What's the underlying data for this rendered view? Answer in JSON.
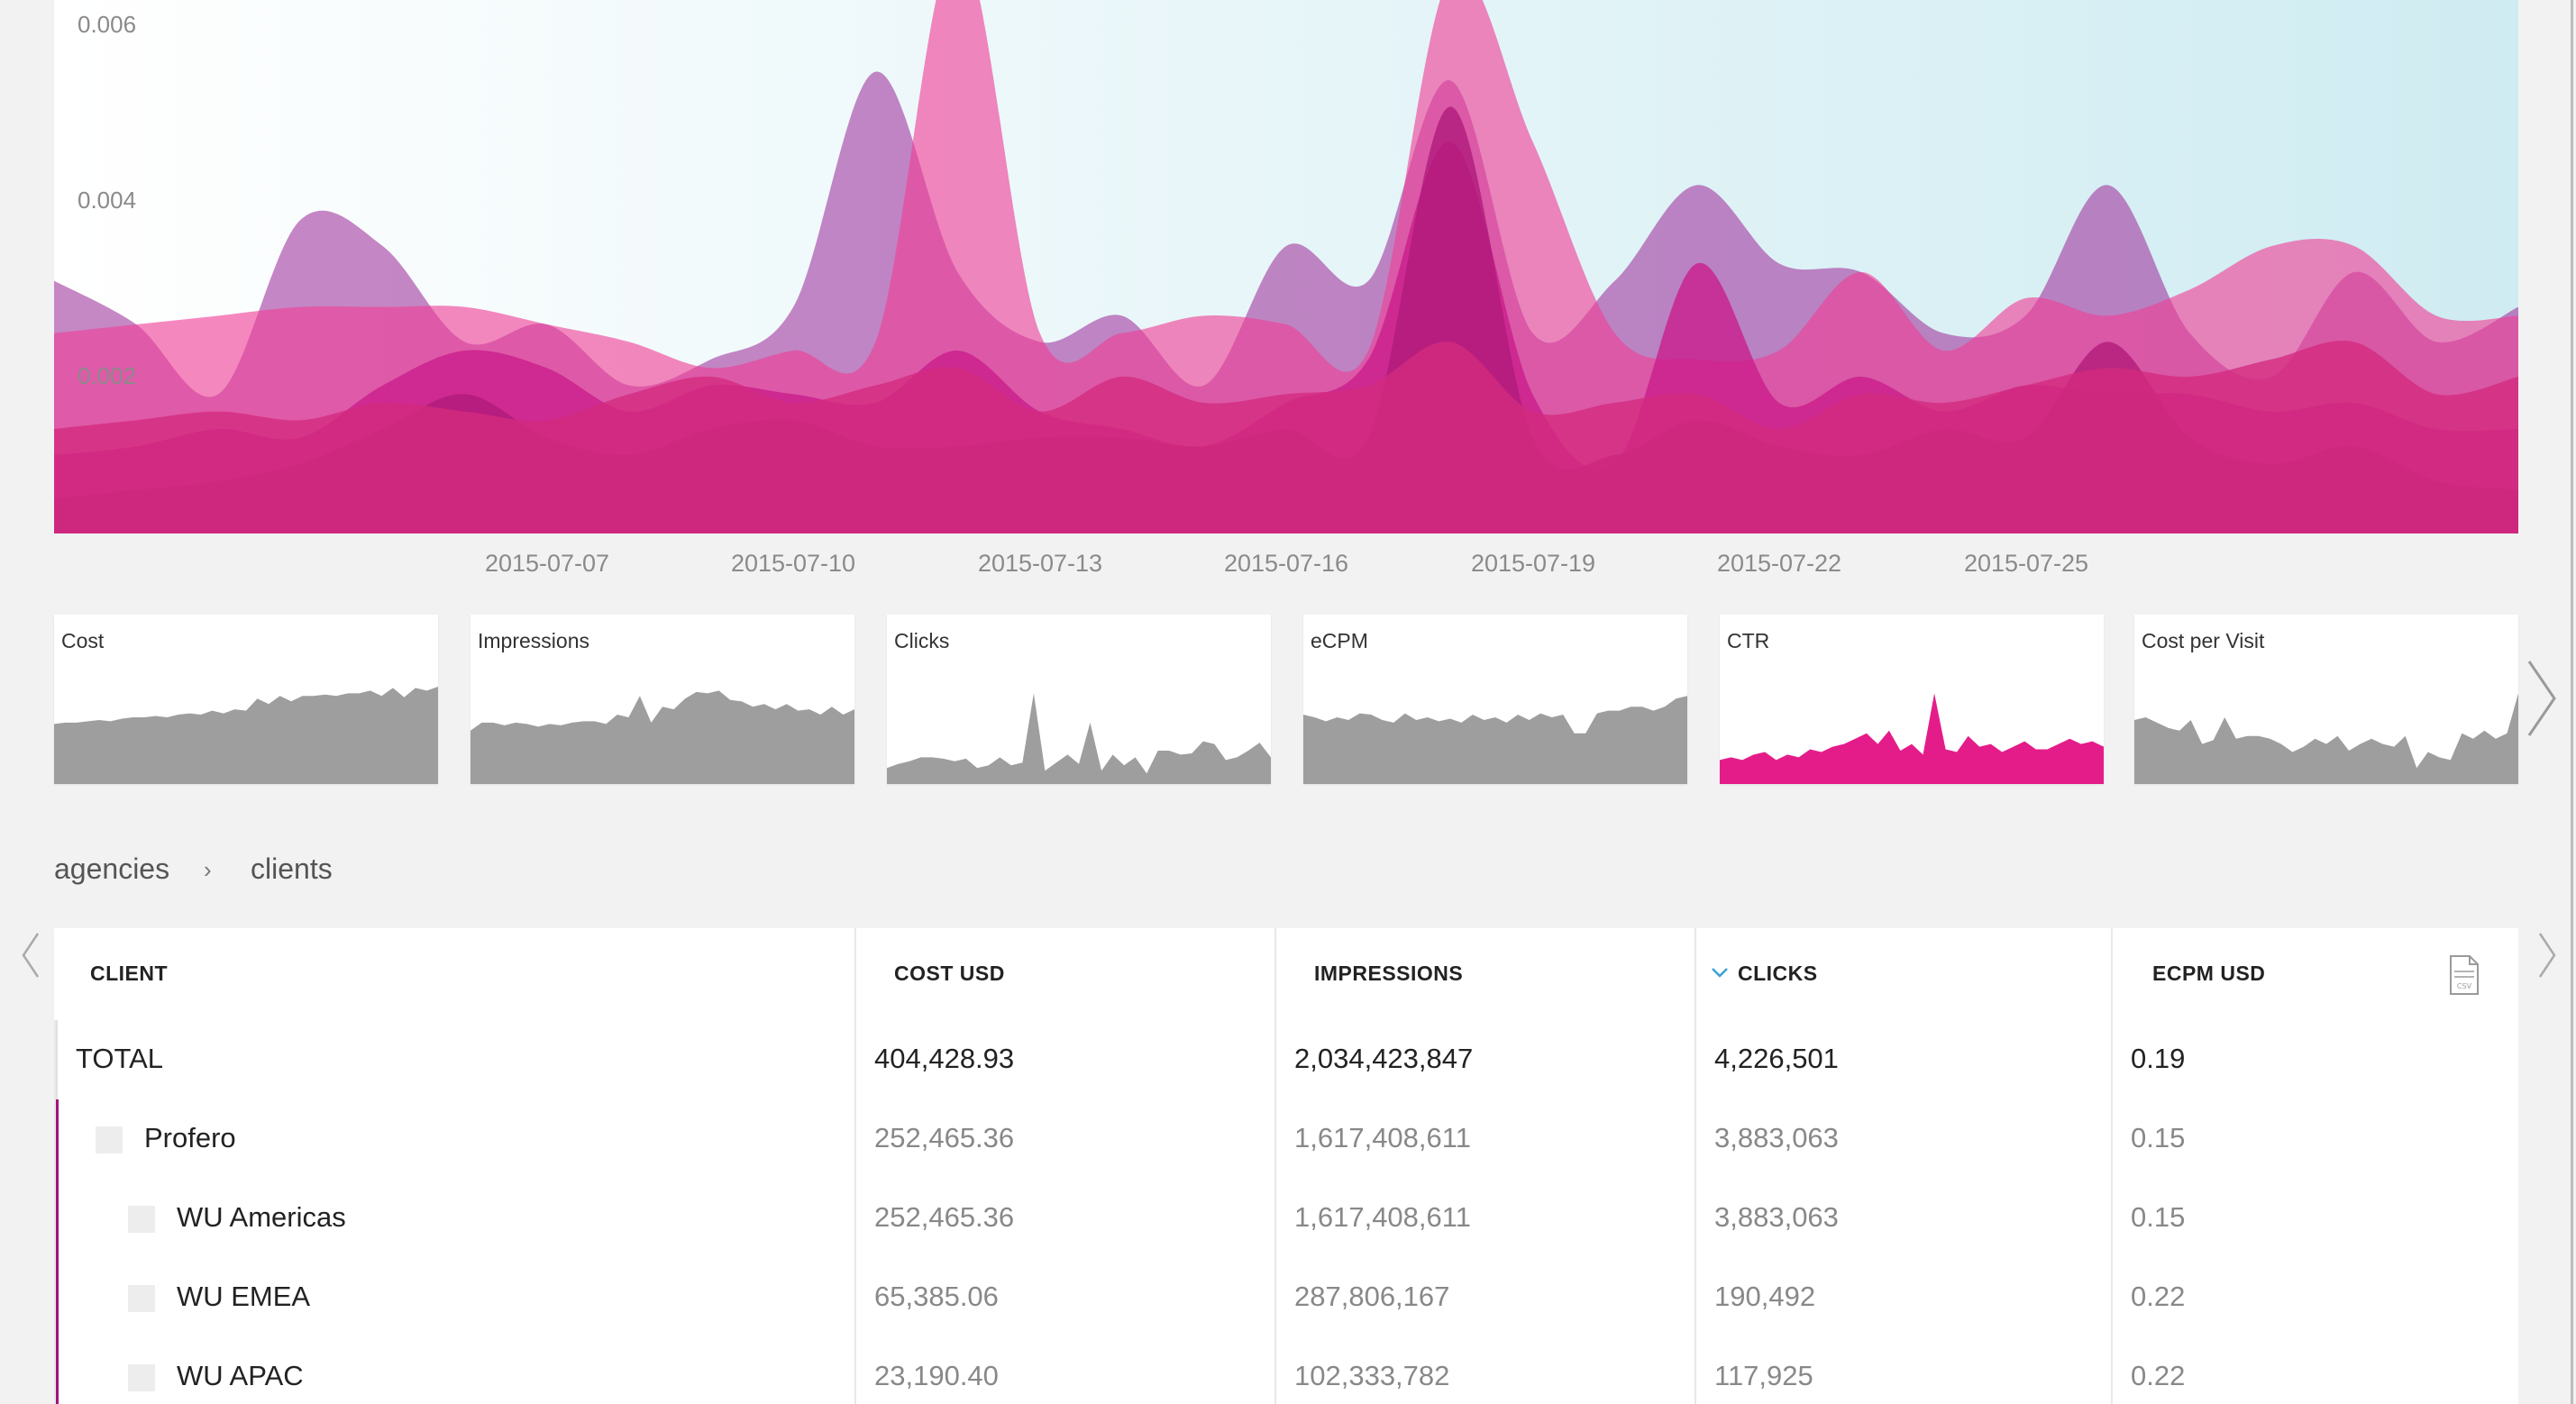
{
  "main_chart": {
    "y_ticks": [
      "0.006",
      "0.004",
      "0.002"
    ],
    "x_ticks": [
      "2015-07-07",
      "2015-07-10",
      "2015-07-13",
      "2015-07-16",
      "2015-07-19",
      "2015-07-22",
      "2015-07-25"
    ],
    "colors": [
      "#a33ea1",
      "#ef3f96",
      "#c91c8a",
      "#b01a7a",
      "#d42a7e"
    ]
  },
  "chart_data": {
    "type": "area",
    "x": [
      "2015-07-02",
      "2015-07-03",
      "2015-07-04",
      "2015-07-05",
      "2015-07-06",
      "2015-07-07",
      "2015-07-08",
      "2015-07-09",
      "2015-07-10",
      "2015-07-11",
      "2015-07-12",
      "2015-07-13",
      "2015-07-14",
      "2015-07-15",
      "2015-07-16",
      "2015-07-17",
      "2015-07-18",
      "2015-07-19",
      "2015-07-20",
      "2015-07-21",
      "2015-07-22",
      "2015-07-23",
      "2015-07-24",
      "2015-07-25",
      "2015-07-26",
      "2015-07-27",
      "2015-07-28",
      "2015-07-29",
      "2015-07-30",
      "2015-07-31",
      "2015-08-01"
    ],
    "ylim": [
      0,
      0.006
    ],
    "series": [
      {
        "values": [
          0.0029,
          0.0024,
          0.0016,
          0.0036,
          0.0033,
          0.0022,
          0.0024,
          0.0017,
          0.002,
          0.0026,
          0.0053,
          0.003,
          0.0022,
          0.0025,
          0.0017,
          0.0033,
          0.0029,
          0.0052,
          0.0023,
          0.0029,
          0.004,
          0.0031,
          0.003,
          0.0023,
          0.0025,
          0.004,
          0.0023,
          0.0018,
          0.003,
          0.0022,
          0.0026
        ]
      },
      {
        "values": [
          0.0023,
          0.0024,
          0.0025,
          0.0026,
          0.0026,
          0.0026,
          0.0024,
          0.0022,
          0.0019,
          0.0021,
          0.0022,
          0.0068,
          0.0023,
          0.0023,
          0.0025,
          0.0024,
          0.0021,
          0.0064,
          0.0045,
          0.0023,
          0.002,
          0.0021,
          0.003,
          0.0021,
          0.0027,
          0.0025,
          0.0028,
          0.0033,
          0.0033,
          0.0025,
          0.0025
        ]
      },
      {
        "values": [
          0.0009,
          0.001,
          0.0012,
          0.0011,
          0.0017,
          0.0021,
          0.0019,
          0.0014,
          0.0017,
          0.0016,
          0.0015,
          0.0021,
          0.0014,
          0.0012,
          0.001,
          0.0015,
          0.002,
          0.0045,
          0.0016,
          0.0008,
          0.0031,
          0.0015,
          0.0018,
          0.0014,
          0.0017,
          0.0016,
          0.0016,
          0.0014,
          0.0015,
          0.0012,
          0.0012
        ]
      },
      {
        "values": [
          0.0004,
          0.0005,
          0.0006,
          0.0008,
          0.0012,
          0.0016,
          0.0011,
          0.0009,
          0.0012,
          0.0013,
          0.001,
          0.001,
          0.0011,
          0.0011,
          0.001,
          0.0012,
          0.0011,
          0.0049,
          0.0011,
          0.0009,
          0.0013,
          0.001,
          0.0009,
          0.0012,
          0.0011,
          0.0022,
          0.0011,
          0.0008,
          0.001,
          0.0006,
          0.0005
        ]
      },
      {
        "values": [
          0.0012,
          0.0013,
          0.0014,
          0.0013,
          0.0015,
          0.0014,
          0.0013,
          0.0016,
          0.0018,
          0.0015,
          0.0017,
          0.0019,
          0.0014,
          0.0018,
          0.0015,
          0.0016,
          0.0017,
          0.0022,
          0.0014,
          0.0015,
          0.0016,
          0.0012,
          0.0016,
          0.0015,
          0.0017,
          0.0019,
          0.0018,
          0.002,
          0.0022,
          0.0016,
          0.0018
        ]
      }
    ]
  },
  "mini_charts": [
    {
      "label": "Cost",
      "color": "#9e9e9e",
      "values": [
        0.45,
        0.46,
        0.46,
        0.47,
        0.48,
        0.47,
        0.49,
        0.5,
        0.5,
        0.51,
        0.5,
        0.52,
        0.53,
        0.52,
        0.55,
        0.53,
        0.56,
        0.55,
        0.64,
        0.6,
        0.66,
        0.62,
        0.66,
        0.66,
        0.67,
        0.66,
        0.68,
        0.68,
        0.7,
        0.66,
        0.72,
        0.65,
        0.72,
        0.7,
        0.73
      ]
    },
    {
      "label": "Impressions",
      "color": "#9e9e9e",
      "values": [
        0.4,
        0.46,
        0.46,
        0.44,
        0.46,
        0.45,
        0.43,
        0.45,
        0.44,
        0.46,
        0.47,
        0.47,
        0.45,
        0.52,
        0.5,
        0.66,
        0.46,
        0.58,
        0.56,
        0.64,
        0.69,
        0.68,
        0.7,
        0.63,
        0.62,
        0.58,
        0.6,
        0.56,
        0.6,
        0.55,
        0.56,
        0.52,
        0.58,
        0.52,
        0.56
      ]
    },
    {
      "label": "Clicks",
      "color": "#9e9e9e",
      "values": [
        0.12,
        0.15,
        0.17,
        0.2,
        0.2,
        0.19,
        0.17,
        0.19,
        0.12,
        0.14,
        0.2,
        0.14,
        0.16,
        0.68,
        0.1,
        0.16,
        0.22,
        0.15,
        0.46,
        0.1,
        0.22,
        0.14,
        0.2,
        0.08,
        0.25,
        0.25,
        0.22,
        0.23,
        0.32,
        0.3,
        0.18,
        0.2,
        0.25,
        0.31,
        0.2
      ]
    },
    {
      "label": "eCPM",
      "color": "#9e9e9e",
      "values": [
        0.52,
        0.5,
        0.47,
        0.5,
        0.48,
        0.53,
        0.52,
        0.48,
        0.46,
        0.53,
        0.48,
        0.5,
        0.47,
        0.49,
        0.46,
        0.52,
        0.48,
        0.5,
        0.46,
        0.52,
        0.48,
        0.53,
        0.5,
        0.52,
        0.38,
        0.38,
        0.53,
        0.55,
        0.55,
        0.58,
        0.58,
        0.55,
        0.58,
        0.64,
        0.66
      ]
    },
    {
      "label": "CTR",
      "color": "#e41c8a",
      "values": [
        0.18,
        0.2,
        0.18,
        0.22,
        0.24,
        0.18,
        0.22,
        0.2,
        0.26,
        0.24,
        0.28,
        0.3,
        0.34,
        0.38,
        0.3,
        0.4,
        0.25,
        0.3,
        0.22,
        0.68,
        0.26,
        0.24,
        0.36,
        0.28,
        0.3,
        0.24,
        0.28,
        0.32,
        0.26,
        0.26,
        0.3,
        0.34,
        0.3,
        0.32,
        0.28
      ]
    },
    {
      "label": "Cost per Visit",
      "color": "#9e9e9e",
      "values": [
        0.48,
        0.5,
        0.46,
        0.42,
        0.4,
        0.48,
        0.3,
        0.33,
        0.5,
        0.34,
        0.36,
        0.36,
        0.34,
        0.3,
        0.24,
        0.28,
        0.34,
        0.3,
        0.36,
        0.25,
        0.3,
        0.34,
        0.3,
        0.28,
        0.36,
        0.12,
        0.24,
        0.2,
        0.18,
        0.38,
        0.34,
        0.4,
        0.34,
        0.38,
        0.68
      ]
    }
  ],
  "breadcrumb": {
    "items": [
      "agencies",
      "clients"
    ],
    "separator": "›"
  },
  "table": {
    "columns": [
      "CLIENT",
      "COST USD",
      "IMPRESSIONS",
      "CLICKS",
      "ECPM USD"
    ],
    "sorted_column": "CLICKS",
    "total": {
      "name": "TOTAL",
      "cost": "404,428.93",
      "impressions": "2,034,423,847",
      "clicks": "4,226,501",
      "ecpm": "0.19"
    },
    "rows": [
      {
        "name": "Profero",
        "cost": "252,465.36",
        "impressions": "1,617,408,611",
        "clicks": "3,883,063",
        "ecpm": "0.15"
      },
      {
        "name": "WU Americas",
        "cost": "252,465.36",
        "impressions": "1,617,408,611",
        "clicks": "3,883,063",
        "ecpm": "0.15"
      },
      {
        "name": "WU EMEA",
        "cost": "65,385.06",
        "impressions": "287,806,167",
        "clicks": "190,492",
        "ecpm": "0.22"
      },
      {
        "name": "WU APAC",
        "cost": "23,190.40",
        "impressions": "102,333,782",
        "clicks": "117,925",
        "ecpm": "0.22"
      }
    ]
  }
}
